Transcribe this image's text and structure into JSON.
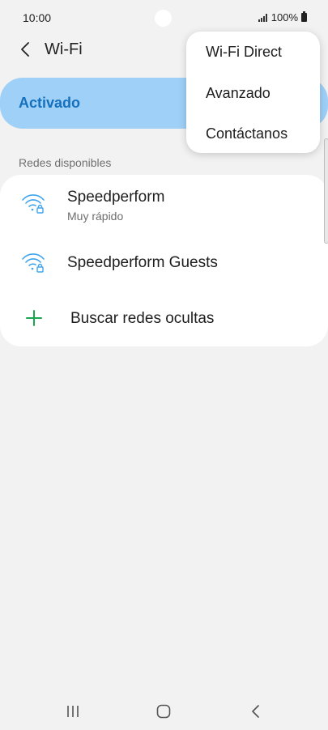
{
  "status_bar": {
    "time": "10:00",
    "battery": "100%"
  },
  "header": {
    "title": "Wi-Fi",
    "back_icon": "chevron-left-icon"
  },
  "wifi_toggle": {
    "label": "Activado"
  },
  "available_networks": {
    "heading": "Redes disponibles",
    "networks": [
      {
        "name": "Speedperform",
        "subtitle": "Muy rápido",
        "icon": "wifi-lock-icon"
      },
      {
        "name": "Speedperform Guests",
        "icon": "wifi-lock-icon"
      }
    ],
    "hidden_networks_label": "Buscar redes ocultas"
  },
  "overflow_menu": {
    "items": [
      {
        "label": "Wi-Fi Direct"
      },
      {
        "label": "Avanzado"
      },
      {
        "label": "Contáctanos"
      }
    ]
  },
  "colors": {
    "accent": "#1570bd",
    "toggle_background": "#9fd0f7",
    "wifi_icon": "#3ea5ee",
    "plus_icon": "#19a84f",
    "page_background": "#f2f2f2"
  },
  "nav_icons": [
    "recent-apps-icon",
    "home-icon",
    "back-icon"
  ]
}
